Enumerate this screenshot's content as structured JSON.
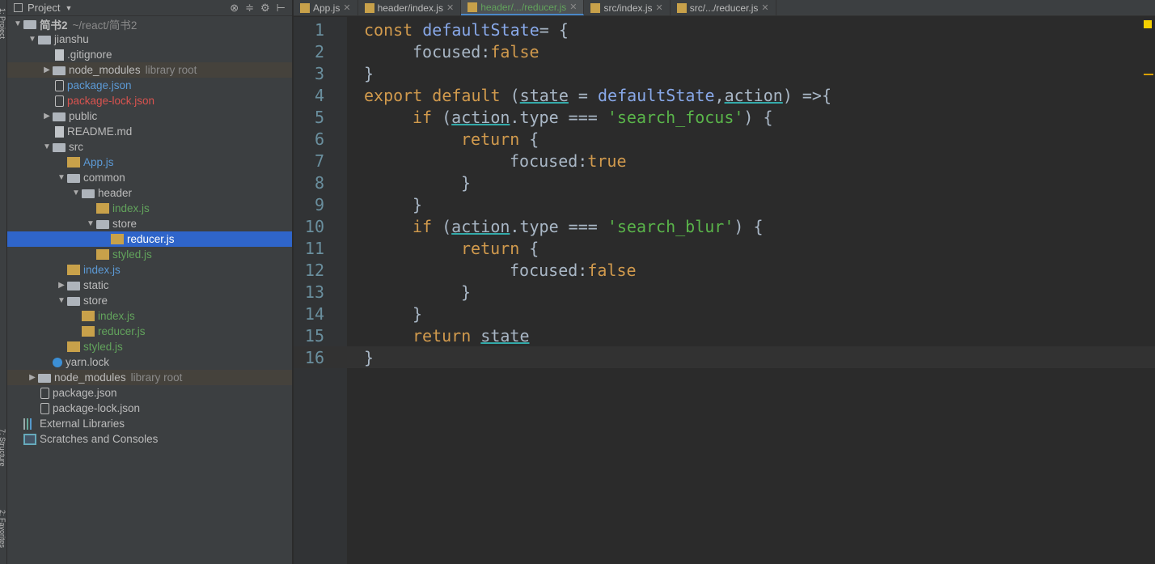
{
  "left_strip": [
    "1: Project",
    "7: Structure",
    "2: Favorites"
  ],
  "sidebar": {
    "title": "Project",
    "rows": [
      {
        "depth": 0,
        "open": true,
        "icon": "folder",
        "label": "简书2",
        "hint": "~/react/简书2"
      },
      {
        "depth": 1,
        "open": true,
        "icon": "folder",
        "label": "jianshu"
      },
      {
        "depth": 2,
        "icon": "file",
        "label": ".gitignore"
      },
      {
        "depth": 2,
        "open": false,
        "icon": "folder",
        "label": "node_modules",
        "hint": "library root",
        "lib": true
      },
      {
        "depth": 2,
        "icon": "json",
        "label": "package.json",
        "color": "blue"
      },
      {
        "depth": 2,
        "icon": "json",
        "label": "package-lock.json",
        "color": "red"
      },
      {
        "depth": 2,
        "open": false,
        "icon": "folder",
        "label": "public"
      },
      {
        "depth": 2,
        "icon": "file",
        "label": "README.md"
      },
      {
        "depth": 2,
        "open": true,
        "icon": "folder",
        "label": "src"
      },
      {
        "depth": 3,
        "icon": "js",
        "label": "App.js",
        "color": "blue"
      },
      {
        "depth": 3,
        "open": true,
        "icon": "folder",
        "label": "common"
      },
      {
        "depth": 4,
        "open": true,
        "icon": "folder",
        "label": "header"
      },
      {
        "depth": 5,
        "icon": "js",
        "label": "index.js",
        "color": "green"
      },
      {
        "depth": 5,
        "open": true,
        "icon": "folder",
        "label": "store"
      },
      {
        "depth": 6,
        "icon": "js",
        "label": "reducer.js",
        "selected": true
      },
      {
        "depth": 5,
        "icon": "js",
        "label": "styled.js",
        "color": "green"
      },
      {
        "depth": 3,
        "icon": "js",
        "label": "index.js",
        "color": "blue"
      },
      {
        "depth": 3,
        "open": false,
        "icon": "folder",
        "label": "static"
      },
      {
        "depth": 3,
        "open": true,
        "icon": "folder",
        "label": "store"
      },
      {
        "depth": 4,
        "icon": "js",
        "label": "index.js",
        "color": "green"
      },
      {
        "depth": 4,
        "icon": "js",
        "label": "reducer.js",
        "color": "green"
      },
      {
        "depth": 3,
        "icon": "js",
        "label": "styled.js",
        "color": "green"
      },
      {
        "depth": 2,
        "icon": "yarn",
        "label": "yarn.lock"
      },
      {
        "depth": 1,
        "open": false,
        "icon": "folder",
        "label": "node_modules",
        "hint": "library root",
        "lib": true
      },
      {
        "depth": 1,
        "icon": "json",
        "label": "package.json"
      },
      {
        "depth": 1,
        "icon": "json",
        "label": "package-lock.json"
      },
      {
        "depth": 0,
        "icon": "libs",
        "label": "External Libraries"
      },
      {
        "depth": 0,
        "icon": "scr",
        "label": "Scratches and Consoles"
      }
    ]
  },
  "tabs": [
    {
      "label": "App.js"
    },
    {
      "label": "header/index.js"
    },
    {
      "label": "header/.../reducer.js",
      "active": true
    },
    {
      "label": "src/index.js"
    },
    {
      "label": "src/.../reducer.js"
    }
  ],
  "editor": {
    "current_line": 16,
    "lines": [
      {
        "indent": 0,
        "tokens": [
          [
            "kw",
            "const "
          ],
          [
            "fn",
            "defaultState"
          ],
          [
            "",
            "= {"
          ]
        ]
      },
      {
        "indent": 1,
        "tokens": [
          [
            "",
            "focused:"
          ],
          [
            "kw",
            "false"
          ]
        ]
      },
      {
        "indent": 0,
        "tokens": [
          [
            "",
            "}"
          ]
        ]
      },
      {
        "indent": 0,
        "tokens": [
          [
            "kw",
            "export default "
          ],
          [
            "",
            "("
          ],
          [
            "u",
            "state"
          ],
          [
            "",
            ""
          ],
          [
            "",
            " = "
          ],
          [
            "fn",
            "defaultState"
          ],
          [
            "",
            ","
          ],
          [
            "u",
            "action"
          ],
          [
            "",
            ") =>{"
          ]
        ]
      },
      {
        "indent": 1,
        "tokens": [
          [
            "kw",
            "if "
          ],
          [
            "",
            "("
          ],
          [
            "u",
            "action"
          ],
          [
            "",
            ".type === "
          ],
          [
            "str",
            "'search_focus'"
          ],
          [
            "",
            ") {"
          ]
        ]
      },
      {
        "indent": 2,
        "tokens": [
          [
            "kw",
            "return "
          ],
          [
            "",
            "{"
          ]
        ]
      },
      {
        "indent": 3,
        "tokens": [
          [
            "",
            "focused:"
          ],
          [
            "kw",
            "true"
          ]
        ]
      },
      {
        "indent": 2,
        "tokens": [
          [
            "",
            "}"
          ]
        ]
      },
      {
        "indent": 1,
        "tokens": [
          [
            "",
            "}"
          ]
        ]
      },
      {
        "indent": 1,
        "tokens": [
          [
            "kw",
            "if "
          ],
          [
            "",
            "("
          ],
          [
            "u",
            "action"
          ],
          [
            "",
            ".type === "
          ],
          [
            "str",
            "'search_blur'"
          ],
          [
            "",
            ") {"
          ]
        ]
      },
      {
        "indent": 2,
        "tokens": [
          [
            "kw",
            "return "
          ],
          [
            "",
            "{"
          ]
        ]
      },
      {
        "indent": 3,
        "tokens": [
          [
            "",
            "focused:"
          ],
          [
            "kw",
            "false"
          ]
        ]
      },
      {
        "indent": 2,
        "tokens": [
          [
            "",
            "}"
          ]
        ]
      },
      {
        "indent": 1,
        "tokens": [
          [
            "",
            "}"
          ]
        ]
      },
      {
        "indent": 1,
        "tokens": [
          [
            "kw",
            "return "
          ],
          [
            "u",
            "state"
          ]
        ]
      },
      {
        "indent": 0,
        "tokens": [
          [
            "",
            "}"
          ]
        ]
      }
    ]
  }
}
